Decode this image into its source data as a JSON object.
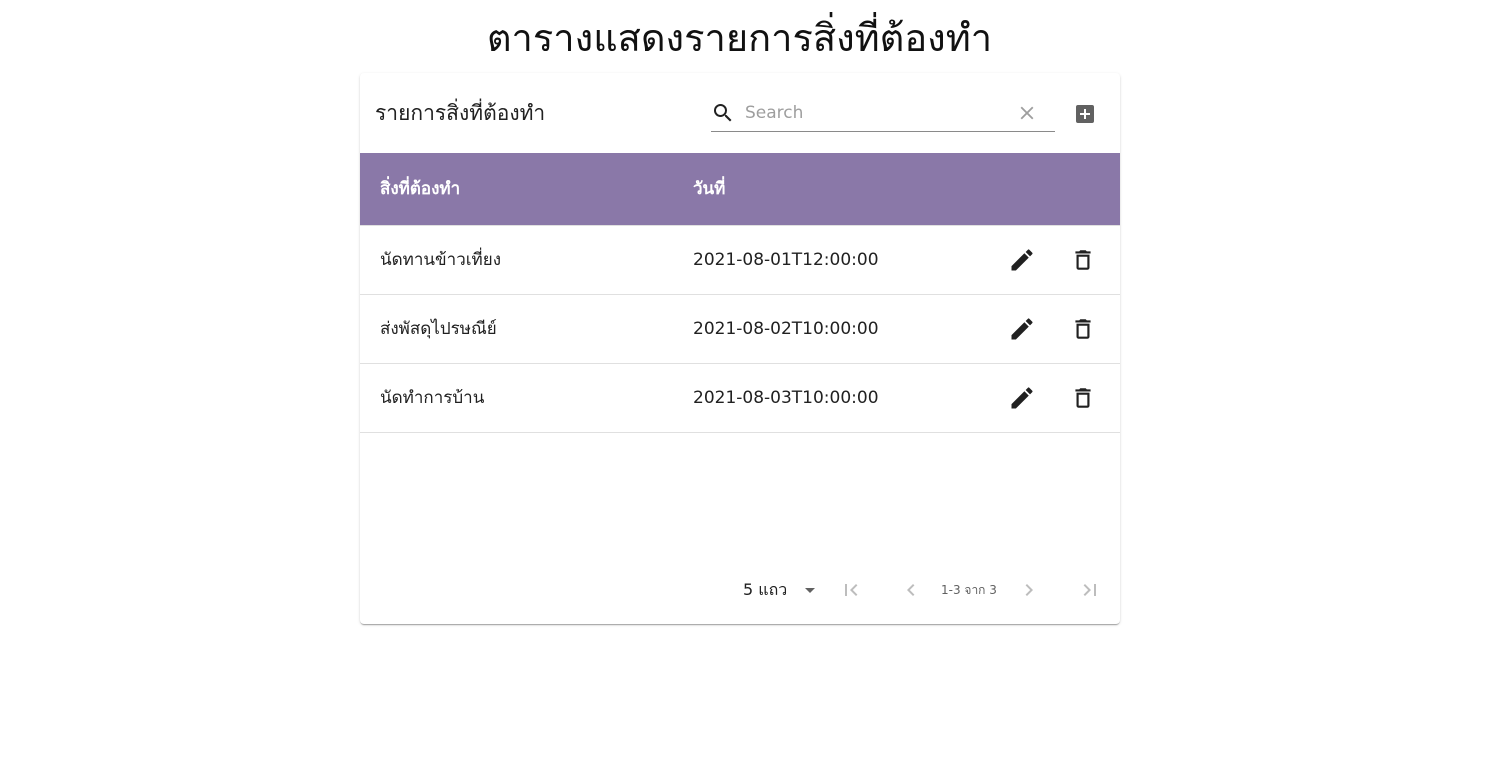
{
  "page": {
    "title": "ตารางแสดงรายการสิ่งที่ต้องทำ"
  },
  "toolbar": {
    "title": "รายการสิ่งที่ต้องทำ",
    "search_placeholder": "Search",
    "search_value": "",
    "icons": {
      "search": "search-icon",
      "clear": "close-icon",
      "add": "add-box-icon"
    }
  },
  "table": {
    "header_color": "#8a78a8",
    "columns": [
      "สิ่งที่ต้องทำ",
      "วันที่"
    ],
    "rows": [
      {
        "task": "นัดทานข้าวเที่ยง",
        "date": "2021-08-01T12:00:00"
      },
      {
        "task": "ส่งพัสดุไปรษณีย์",
        "date": "2021-08-02T10:00:00"
      },
      {
        "task": "นัดทำการบ้าน",
        "date": "2021-08-03T10:00:00"
      }
    ],
    "row_actions": [
      "edit-icon",
      "delete-icon"
    ]
  },
  "pagination": {
    "rows_per_page_label": "5 แถว",
    "info": "1-3 จาก 3"
  }
}
